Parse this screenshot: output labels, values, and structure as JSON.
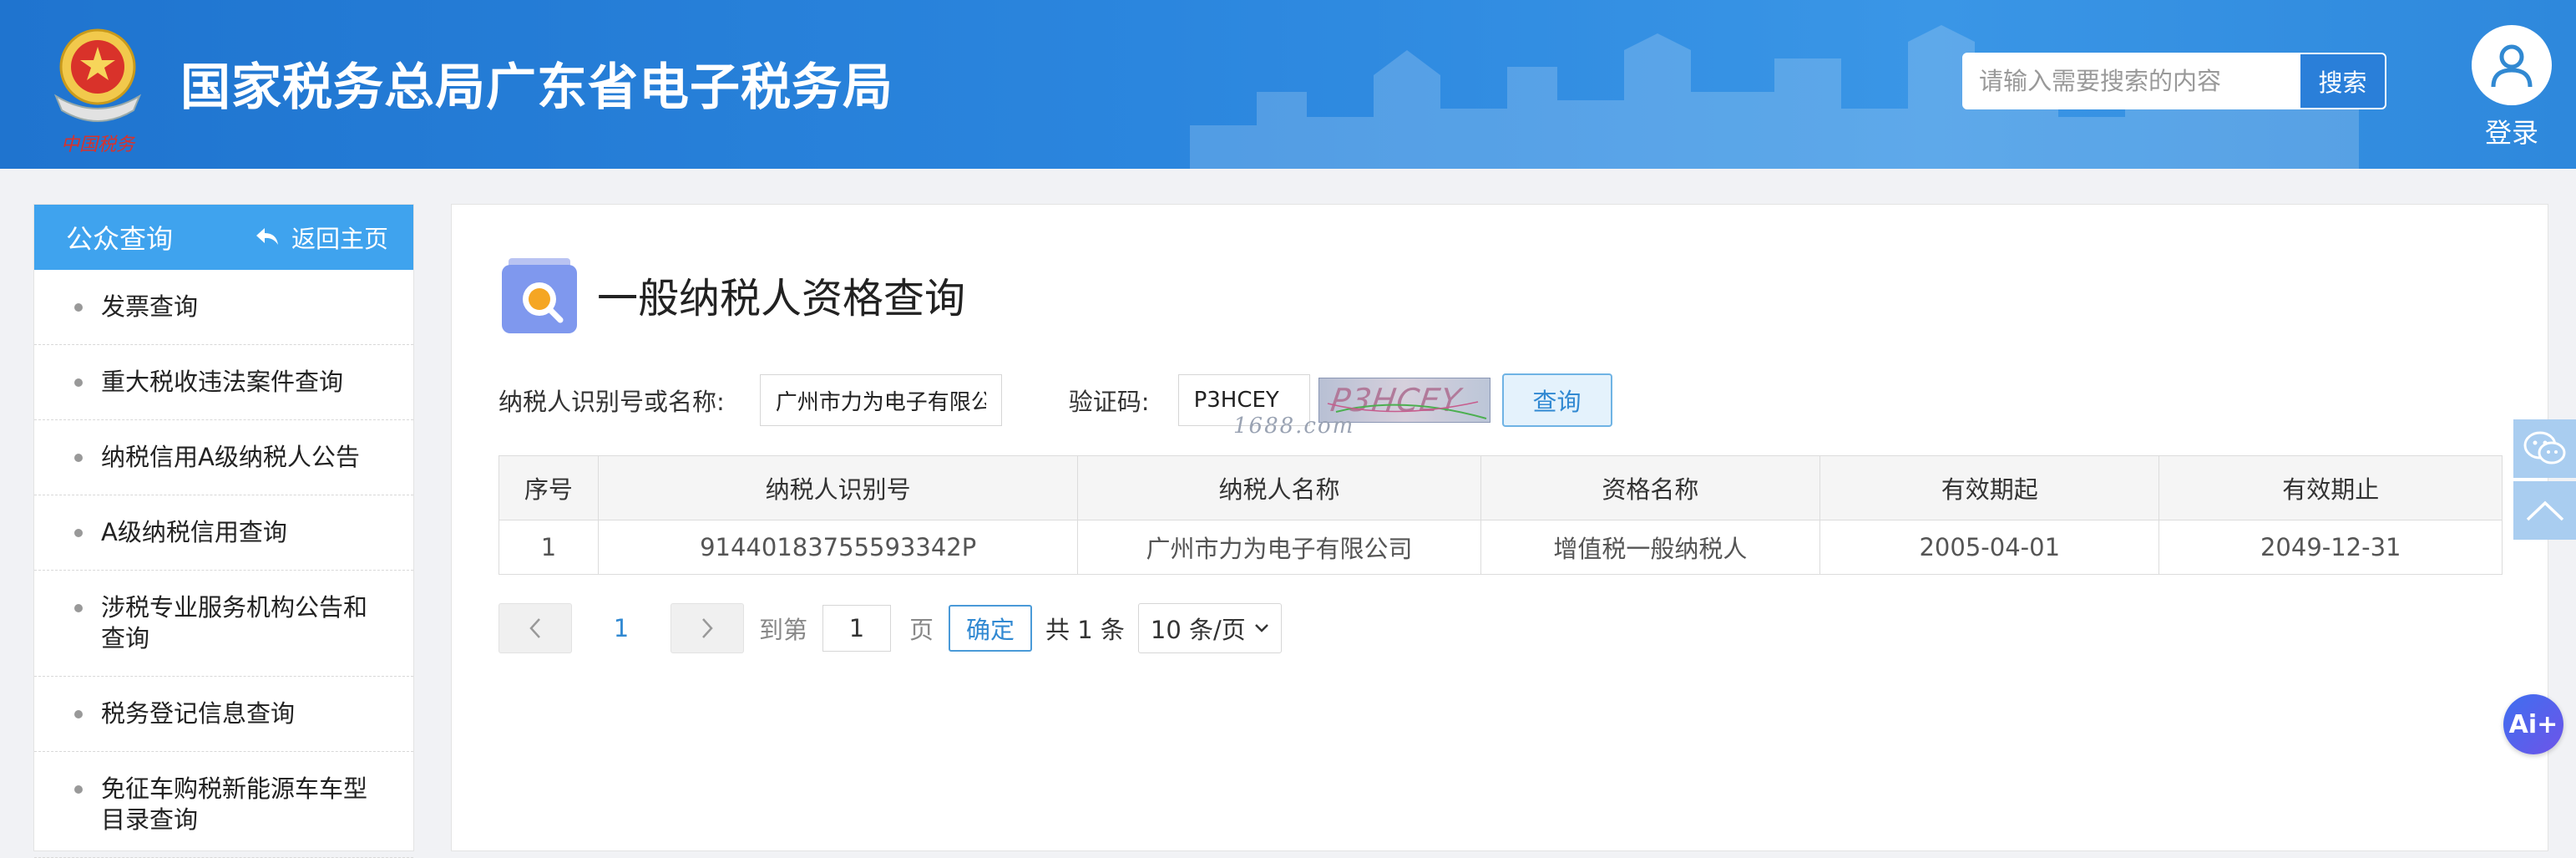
{
  "header": {
    "site_title": "国家税务总局广东省电子税务局",
    "logo_text": "中国税务",
    "search_placeholder": "请输入需要搜索的内容",
    "search_button": "搜索",
    "login_label": "登录"
  },
  "sidebar": {
    "title": "公众查询",
    "back_home": "返回主页",
    "items": [
      {
        "label": "发票查询"
      },
      {
        "label": "重大税收违法案件查询"
      },
      {
        "label": "纳税信用A级纳税人公告"
      },
      {
        "label": "A级纳税信用查询"
      },
      {
        "label": "涉税专业服务机构公告和查询"
      },
      {
        "label": "税务登记信息查询"
      },
      {
        "label": "免征车购税新能源车车型目录查询"
      }
    ]
  },
  "main": {
    "page_title": "一般纳税人资格查询",
    "form": {
      "taxpayer_label": "纳税人识别号或名称:",
      "taxpayer_value": "广州市力为电子有限公司",
      "captcha_label": "验证码:",
      "captcha_value": "P3HCEY",
      "captcha_image_text": "P3HCEY",
      "query_button": "查询",
      "watermark": "1688.com"
    },
    "table": {
      "headers": [
        "序号",
        "纳税人识别号",
        "纳税人名称",
        "资格名称",
        "有效期起",
        "有效期止"
      ],
      "rows": [
        [
          "1",
          "91440183755593342P",
          "广州市力为电子有限公司",
          "增值税一般纳税人",
          "2005-04-01",
          "2049-12-31"
        ]
      ]
    },
    "pagination": {
      "current_page": "1",
      "goto_label": "到第",
      "goto_value": "1",
      "page_unit": "页",
      "confirm": "确定",
      "total": "共 1 条",
      "page_size": "10 条/页"
    }
  },
  "floating": {
    "ai_label": "Ai+"
  },
  "colors": {
    "header_blue": "#2b86de",
    "sidebar_head": "#3fa3ee",
    "link_blue": "#3189d2"
  }
}
